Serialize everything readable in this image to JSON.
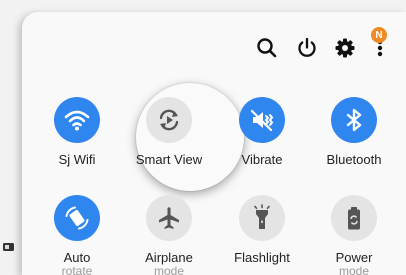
{
  "header": {
    "icons": [
      "search-icon",
      "power-icon",
      "gear-icon",
      "more-vert-icon"
    ],
    "notification_badge": "N"
  },
  "tiles": [
    {
      "label": "Sj Wifi",
      "state": "on",
      "icon": "wifi-icon"
    },
    {
      "label": "Smart View",
      "state": "off",
      "icon": "smart-view-icon",
      "highlighted": true
    },
    {
      "label": "Vibrate",
      "state": "on",
      "icon": "vibrate-icon"
    },
    {
      "label": "Bluetooth",
      "state": "on",
      "icon": "bluetooth-icon"
    },
    {
      "label": "Auto",
      "sublabel": "rotate",
      "state": "on",
      "icon": "auto-rotate-icon"
    },
    {
      "label": "Airplane",
      "sublabel": "mode",
      "state": "off",
      "icon": "airplane-icon"
    },
    {
      "label": "Flashlight",
      "state": "off",
      "icon": "flashlight-icon"
    },
    {
      "label": "Power",
      "sublabel": "mode",
      "state": "off",
      "icon": "power-mode-icon"
    }
  ],
  "colors": {
    "accent": "#2e86ee",
    "inactive": "#e4e4e4",
    "badge": "#f08a24"
  }
}
